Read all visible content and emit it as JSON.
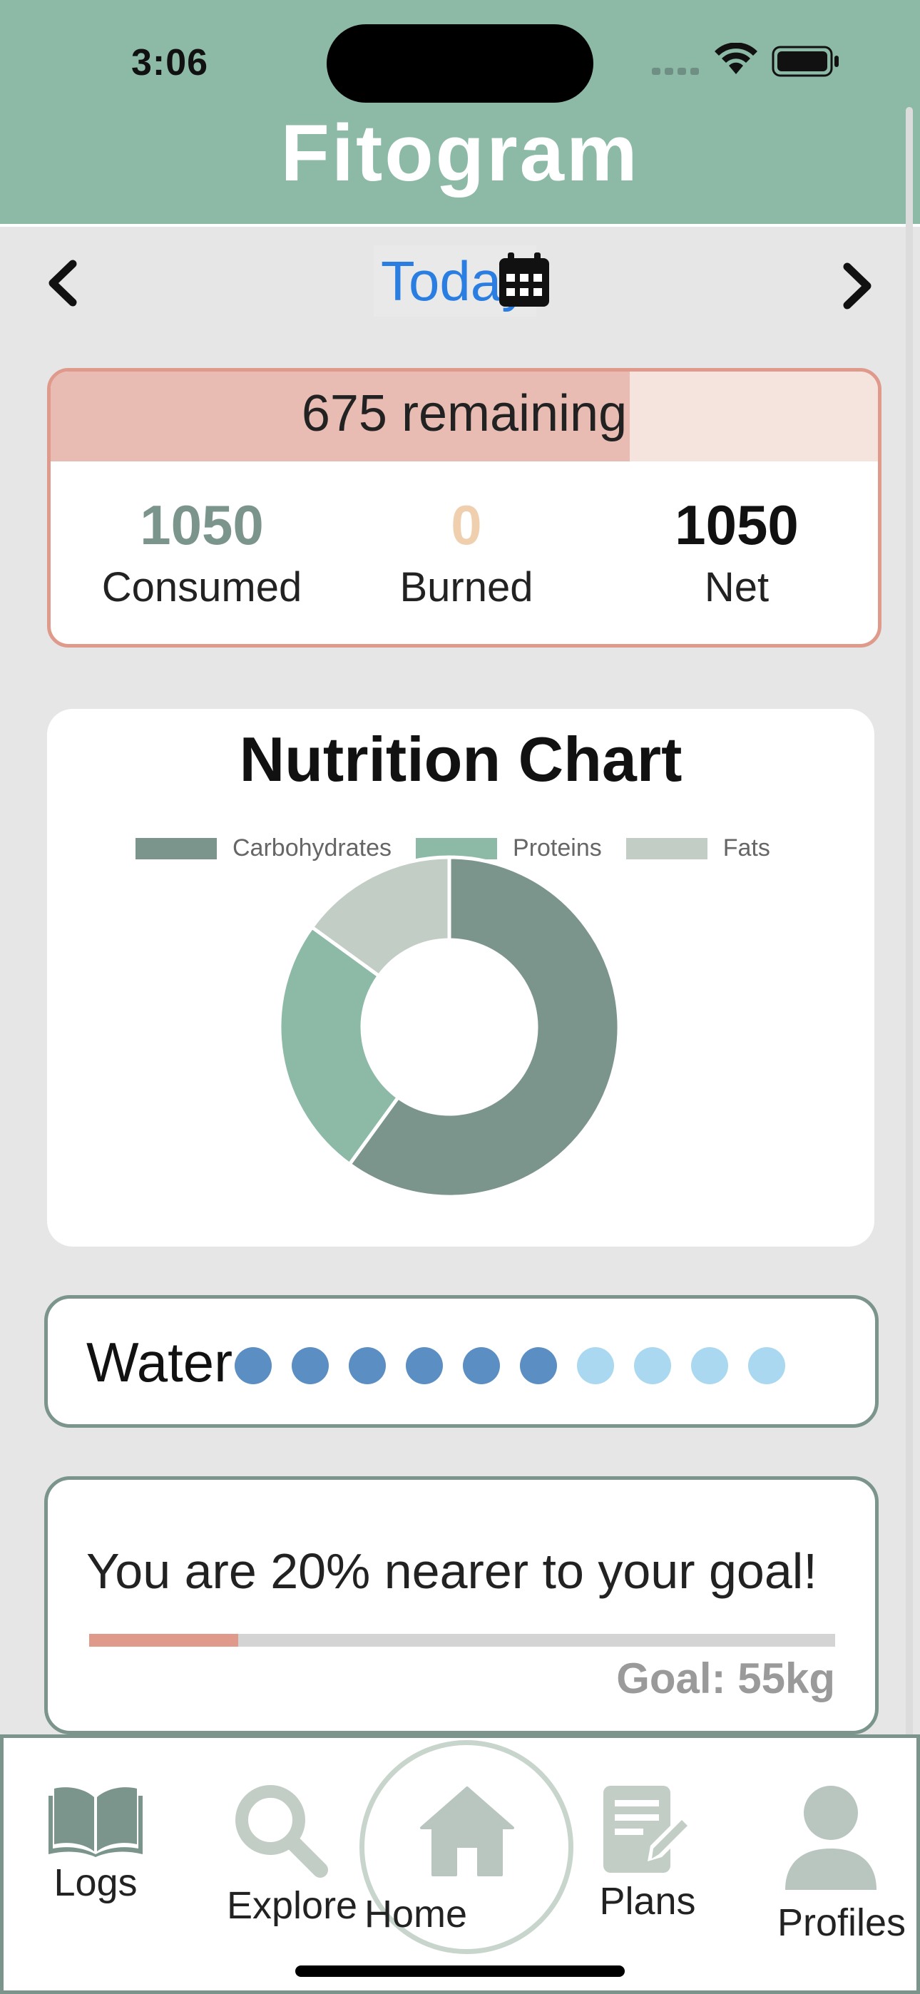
{
  "status_bar": {
    "time": "3:06"
  },
  "app": {
    "title": "Fitogram"
  },
  "date_nav": {
    "label": "Today"
  },
  "calories": {
    "remaining_text": "675 remaining",
    "progress_fraction": 0.7,
    "consumed": {
      "value": "1050",
      "label": "Consumed"
    },
    "burned": {
      "value": "0",
      "label": "Burned"
    },
    "net": {
      "value": "1050",
      "label": "Net"
    }
  },
  "nutrition": {
    "title": "Nutrition Chart",
    "chart_data": {
      "type": "pie",
      "categories": [
        "Carbohydrates",
        "Proteins",
        "Fats"
      ],
      "values": [
        60,
        25,
        15
      ],
      "colors": [
        "#7b958c",
        "#8cbaa7",
        "#c1cdc5"
      ]
    }
  },
  "water": {
    "label": "Water",
    "filled": 6,
    "total": 10,
    "filled_color": "#5b8ec2",
    "empty_color": "#aad8f0"
  },
  "goal": {
    "message": "You are 20% nearer to your goal!",
    "progress_fraction": 0.2,
    "target": "Goal: 55kg"
  },
  "tabs": {
    "logs": "Logs",
    "explore": "Explore",
    "home": "Home",
    "plans": "Plans",
    "profiles": "Profiles"
  },
  "icons": {
    "prev": "chevron-left-icon",
    "next": "chevron-right-icon",
    "calendar": "calendar-icon",
    "logs": "book-icon",
    "explore": "search-icon",
    "home": "home-icon",
    "plans": "edit-icon",
    "profiles": "user-icon"
  }
}
